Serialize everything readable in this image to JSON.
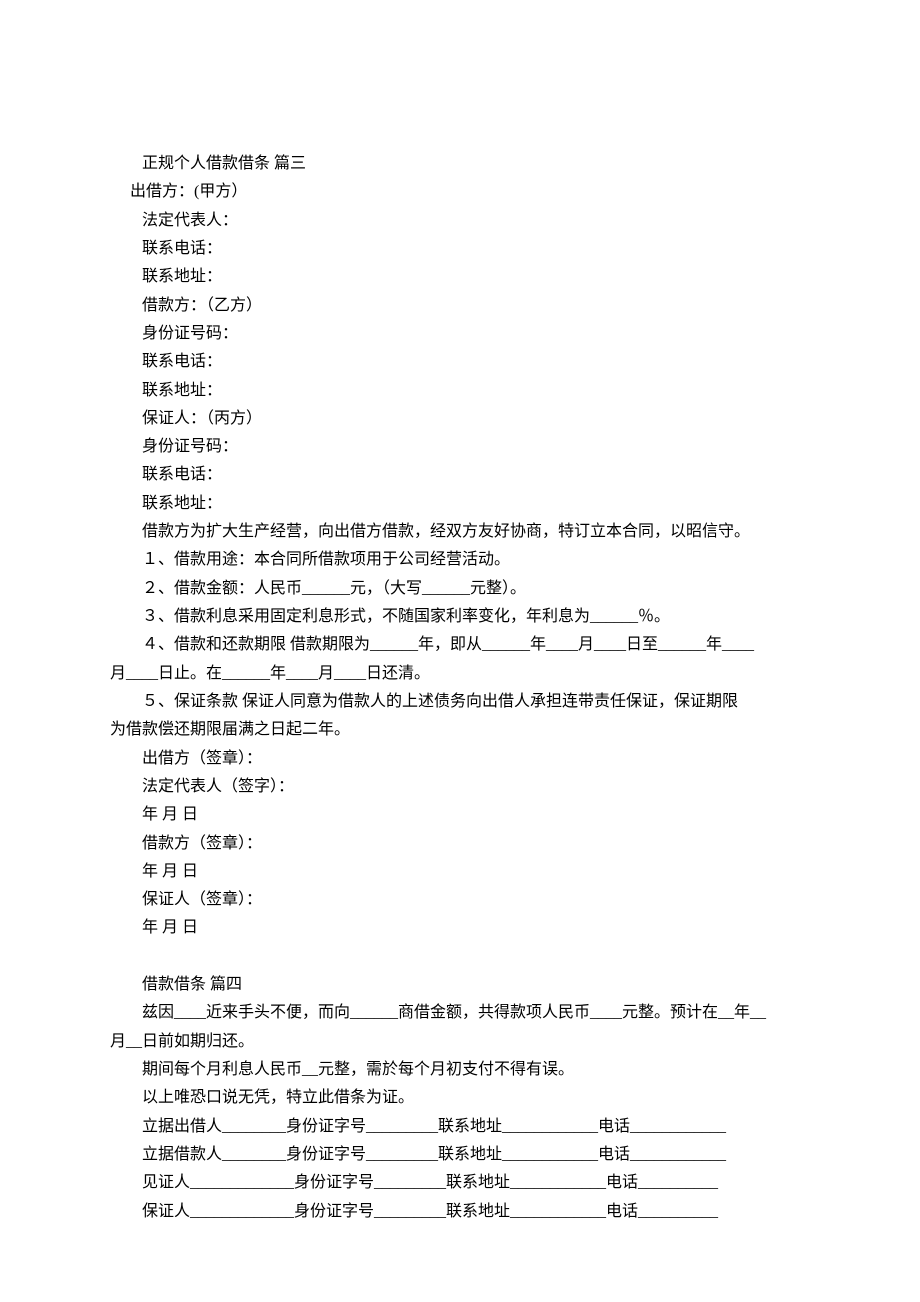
{
  "p3": {
    "title": "正规个人借款借条 篇三",
    "lender_line": "出借方：(甲方）",
    "legal_rep": "法定代表人：",
    "phone": "联系电话：",
    "address": "联系地址：",
    "borrower_party": "借款方：（乙方）",
    "id_number": "身份证号码：",
    "guarantor_party": "保证人：（丙方）",
    "intro": "借款方为扩大生产经营，向出借方借款，经双方友好协商，特订立本合同，以昭信守。",
    "clause1": "１、借款用途：本合同所借款项用于公司经营活动。",
    "clause2": "２、借款金额：人民币______元，（大写______元整）。",
    "clause3": "３、借款利息采用固定利息形式，不随国家利率变化，年利息为______％。",
    "clause4_a": "４、借款和还款期限 借款期限为______年，即从______年____月____日至______年____",
    "clause4_b": "月____日止。在______年____月____日还清。",
    "clause5_a": "５、保证条款 保证人同意为借款人的上述债务向出借人承担连带责任保证，保证期限",
    "clause5_b": "为借款偿还期限届满之日起二年。",
    "lender_sign": "出借方（签章）：",
    "legal_rep_sign": "法定代表人（签字）：",
    "date": "年 月 日",
    "borrower_sign": "借款方（签章）：",
    "guarantor_sign": "保证人（签章）："
  },
  "p4": {
    "title": "借款借条 篇四",
    "intro_a": "兹因____近来手头不便，而向______商借金额，共得款项人民币____元整。预计在__年__",
    "intro_b": "月__日前如期归还。",
    "interest": "期间每个月利息人民币__元整，需於每个月初支付不得有误。",
    "proof": "以上唯恐口说无凭，特立此借条为证。",
    "lender_row": "立据出借人________身份证字号_________联系地址____________电话____________",
    "borrower_row": "立据借款人________身份证字号_________联系地址____________电话____________",
    "witness_row": "见证人_____________身份证字号_________联系地址____________电话__________",
    "guarantor_row": "保证人_____________身份证字号_________联系地址____________电话__________"
  }
}
